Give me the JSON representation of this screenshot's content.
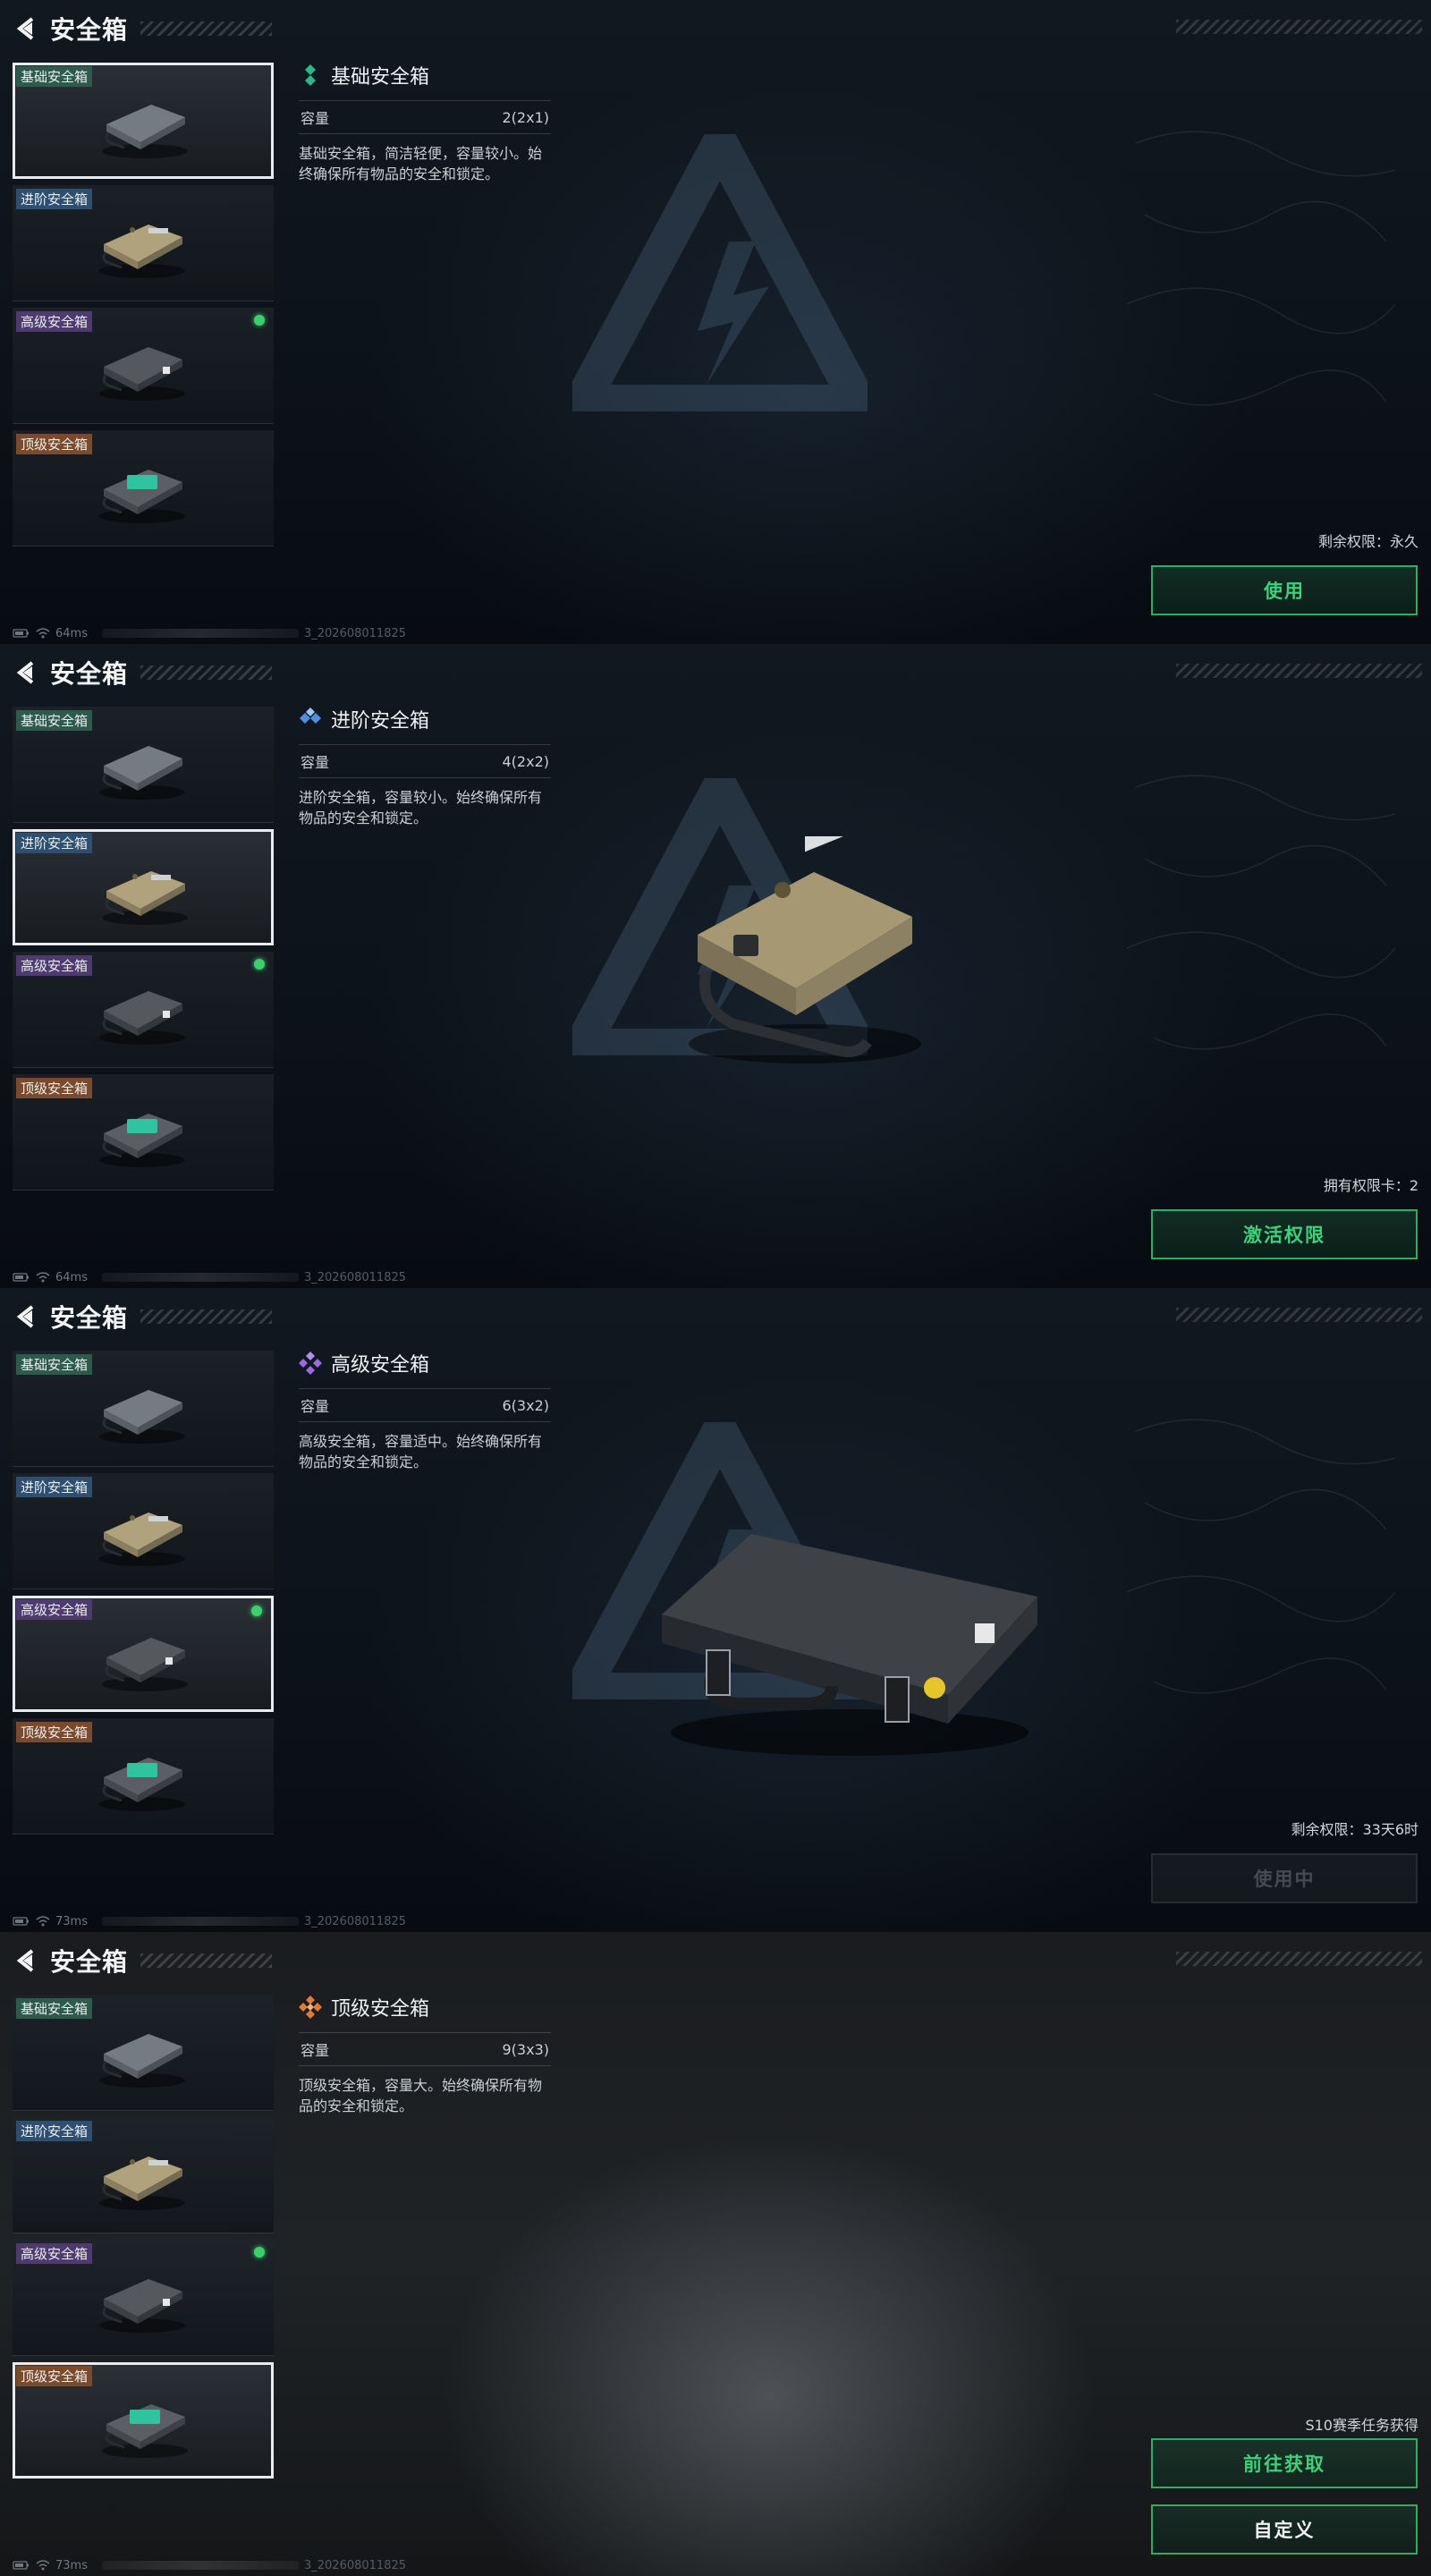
{
  "screen_title": "安全箱",
  "items": [
    {
      "label": "基础安全箱",
      "rarity": "green"
    },
    {
      "label": "进阶安全箱",
      "rarity": "blue"
    },
    {
      "label": "高级安全箱",
      "rarity": "purple",
      "equipped": true
    },
    {
      "label": "顶级安全箱",
      "rarity": "orange"
    }
  ],
  "capacity_label": "容量",
  "panels": [
    {
      "selected_index": 0,
      "name": "基础安全箱",
      "capacity": "2(2x1)",
      "description": "基础安全箱，简洁轻便，容量较小。始终确保所有物品的安全和锁定。",
      "status_text": "剩余权限：永久",
      "buttons": [
        {
          "label": "使用",
          "style": "green"
        }
      ],
      "ping": "64ms",
      "build": "3_202608011825"
    },
    {
      "selected_index": 1,
      "name": "进阶安全箱",
      "capacity": "4(2x2)",
      "description": "进阶安全箱，容量较小。始终确保所有物品的安全和锁定。",
      "status_text": "拥有权限卡：2",
      "buttons": [
        {
          "label": "激活权限",
          "style": "green"
        }
      ],
      "ping": "64ms",
      "build": "3_202608011825"
    },
    {
      "selected_index": 2,
      "name": "高级安全箱",
      "capacity": "6(3x2)",
      "description": "高级安全箱，容量适中。始终确保所有物品的安全和锁定。",
      "status_text": "剩余权限：33天6时",
      "buttons": [
        {
          "label": "使用中",
          "style": "disabled"
        }
      ],
      "ping": "73ms",
      "build": "3_202608011825"
    },
    {
      "selected_index": 3,
      "name": "顶级安全箱",
      "capacity": "9(3x3)",
      "description": "顶级安全箱，容量大。始终确保所有物品的安全和锁定。",
      "status_text": "S10赛季任务获得",
      "buttons": [
        {
          "label": "前往获取",
          "style": "green"
        },
        {
          "label": "自定义",
          "style": "white"
        }
      ],
      "ping": "73ms",
      "build": "3_202608011825"
    }
  ],
  "colors": {
    "accent_green": "#3fd07b",
    "equipped_dot": "#3ad06a",
    "rarity_green": "#2fb58a",
    "rarity_blue": "#4f8fe0",
    "rarity_purple": "#9a6ae0",
    "rarity_orange": "#e07a3a"
  },
  "icons": {
    "back": "back-arrow-icon",
    "wifi": "wifi-icon",
    "battery": "battery-icon"
  }
}
